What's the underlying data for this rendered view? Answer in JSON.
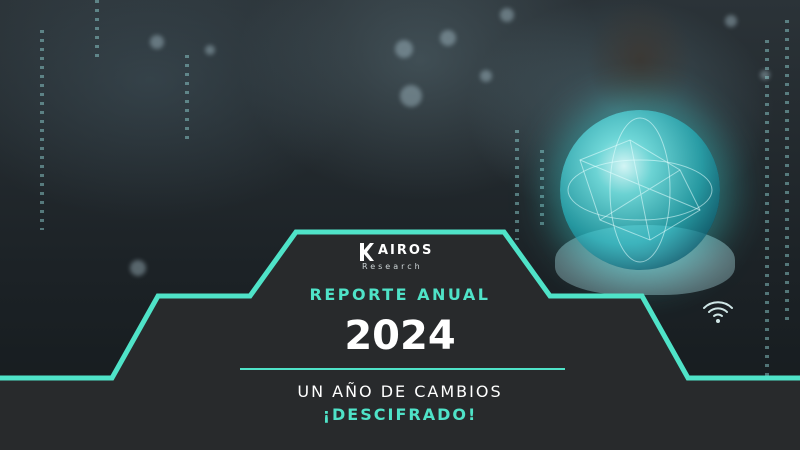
{
  "brand": {
    "name": "AIROS",
    "mark_letter": "K",
    "subtitle": "Research"
  },
  "cover": {
    "report_label": "REPORTE ANUAL",
    "year": "2024",
    "subtitle": "UN AÑO DE CAMBIOS",
    "tagline": "¡DESCIFRADO!"
  },
  "colors": {
    "accent": "#4fe3c8",
    "panel": "#282a2c",
    "text": "#ffffff"
  },
  "icons": [
    "k-logo-icon",
    "wifi-icon",
    "glowing-orb"
  ]
}
